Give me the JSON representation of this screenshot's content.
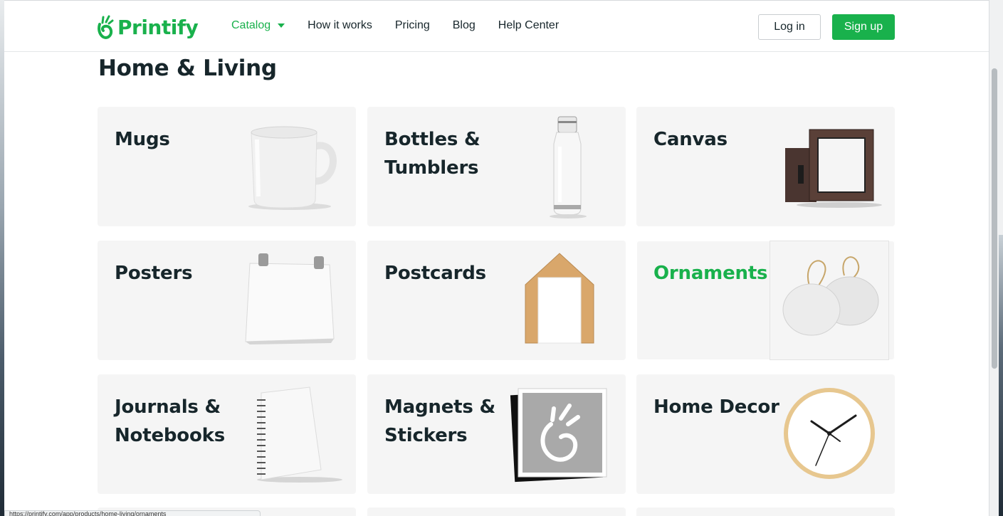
{
  "brand": {
    "name": "Printify",
    "accent": "#19b14c"
  },
  "nav": {
    "items": [
      {
        "label": "Catalog",
        "active": true,
        "has_dropdown": true
      },
      {
        "label": "How it works"
      },
      {
        "label": "Pricing"
      },
      {
        "label": "Blog"
      },
      {
        "label": "Help Center"
      }
    ]
  },
  "auth": {
    "login_label": "Log in",
    "signup_label": "Sign up"
  },
  "section": {
    "title": "Home & Living"
  },
  "categories": [
    {
      "label": "Mugs",
      "icon": "mug-image"
    },
    {
      "label": "Bottles & Tumblers",
      "icon": "bottle-image"
    },
    {
      "label": "Canvas",
      "icon": "canvas-image"
    },
    {
      "label": "Posters",
      "icon": "poster-image"
    },
    {
      "label": "Postcards",
      "icon": "postcard-image"
    },
    {
      "label": "Ornaments",
      "icon": "ornament-image",
      "hovered": true
    },
    {
      "label": "Journals & Notebooks",
      "icon": "notebook-image"
    },
    {
      "label": "Magnets & Stickers",
      "icon": "magnet-image"
    },
    {
      "label": "Home Decor",
      "icon": "clock-image"
    }
  ],
  "status_bar": {
    "url": "https://printify.com/app/products/home-living/ornaments"
  }
}
